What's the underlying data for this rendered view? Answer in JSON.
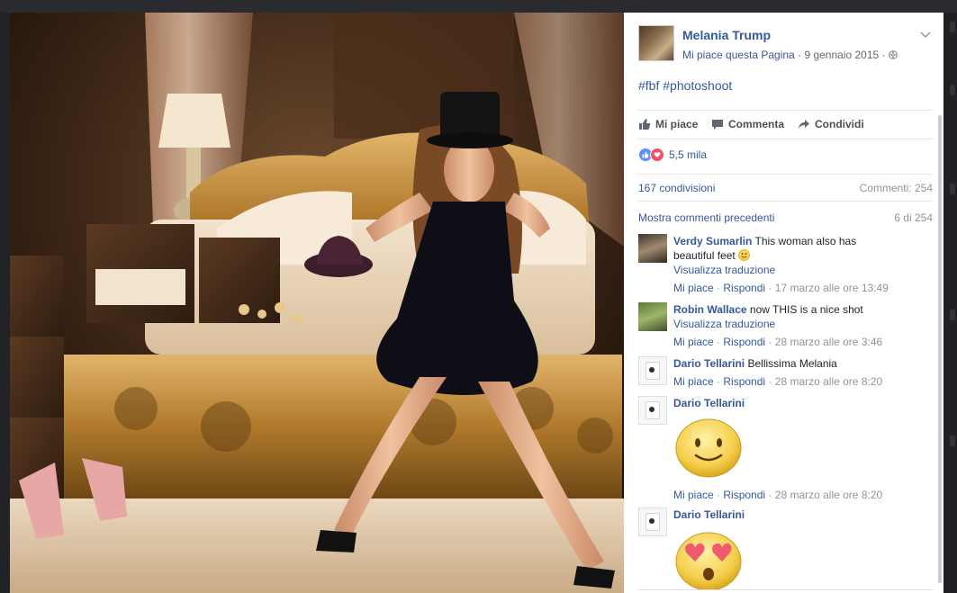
{
  "post": {
    "page_name": "Melania Trump",
    "like_page": "Mi piace questa Pagina",
    "separator": "·",
    "date": "9 gennaio 2015",
    "text": "#fbf #photoshoot"
  },
  "actions": {
    "like": "Mi piace",
    "comment": "Commenta",
    "share": "Condividi"
  },
  "reactions": {
    "count": "5,5 mila"
  },
  "stats": {
    "shares": "167 condivisioni",
    "comments": "Commenti: 254"
  },
  "comments_header": {
    "more_label": "Mostra commenti precedenti",
    "count": "6 di 254"
  },
  "comments": [
    {
      "author": "Verdy Sumarlin",
      "text_line1": "This woman also has",
      "text_line2": "beautiful feet",
      "translate": "Visualizza traduzione",
      "like": "Mi piace",
      "reply": "Rispondi",
      "time": "17 marzo alle ore 13:49"
    },
    {
      "author": "Robin Wallace",
      "text": "now THIS is a nice shot",
      "translate": "Visualizza traduzione",
      "like": "Mi piace",
      "reply": "Rispondi",
      "time": "28 marzo alle ore 3:46"
    },
    {
      "author": "Dario Tellarini",
      "text": "Bellissima Melania",
      "like": "Mi piace",
      "reply": "Rispondi",
      "time": "28 marzo alle ore 8:20"
    },
    {
      "author": "Dario Tellarini",
      "sticker": "smiley-sticker",
      "like": "Mi piace",
      "reply": "Rispondi",
      "time": "28 marzo alle ore 8:20"
    },
    {
      "author": "Dario Tellarini",
      "sticker": "heart-eyes-sticker"
    }
  ],
  "colors": {
    "link": "#365899",
    "meta": "#90949c",
    "like_reaction": "#5890ff",
    "love_reaction": "#f25268"
  }
}
